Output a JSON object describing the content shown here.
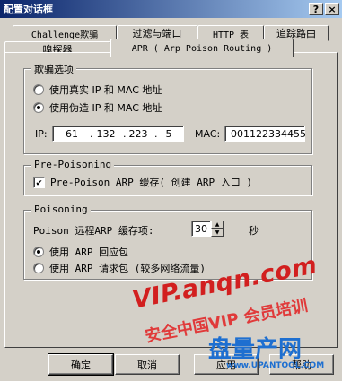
{
  "window": {
    "title": "配置对话框",
    "help_glyph": "?",
    "close_glyph": "×"
  },
  "tabs_back": [
    "Challenge欺骗",
    "过滤与端口",
    "HTTP 表",
    "追踪路由"
  ],
  "tabs_front": [
    "嗅探器",
    "APR ( Arp Poison Routing )"
  ],
  "spoof_group": {
    "title": "欺骗选项",
    "option_real": "使用真实 IP 和 MAC 地址",
    "option_fake": "使用伪造 IP 和 MAC 地址",
    "ip_label": "IP:",
    "ip": [
      "61",
      "132",
      "223",
      "5"
    ],
    "ip_dot": ".",
    "mac_label": "MAC:",
    "mac_value": "001122334455"
  },
  "prepoison_group": {
    "title": "Pre-Poisoning",
    "checkbox_label": "Pre-Poison ARP 缓存( 创建 ARP 入口 )",
    "check_glyph": "✔"
  },
  "poison_group": {
    "title": "Poisoning",
    "interval_label": "Poison 远程ARP 缓存项:",
    "interval_value": "30",
    "interval_unit": "秒",
    "option_reply": "使用 ARP 回应包",
    "option_request": "使用 ARP 请求包 (较多网络流量)"
  },
  "buttons": {
    "ok": "确定",
    "cancel": "取消",
    "apply": "应用",
    "help": "帮助"
  },
  "watermark": {
    "line1": "VIP.anqn.com",
    "line2": "安全中国VIP 会员培训",
    "logo": "盘量产网",
    "logo_sub": "www.UPANTOOL.COM",
    "logo_color": "#1e6fd0",
    "line1_color": "#d21f1f",
    "line2_color": "#e03a3a"
  }
}
